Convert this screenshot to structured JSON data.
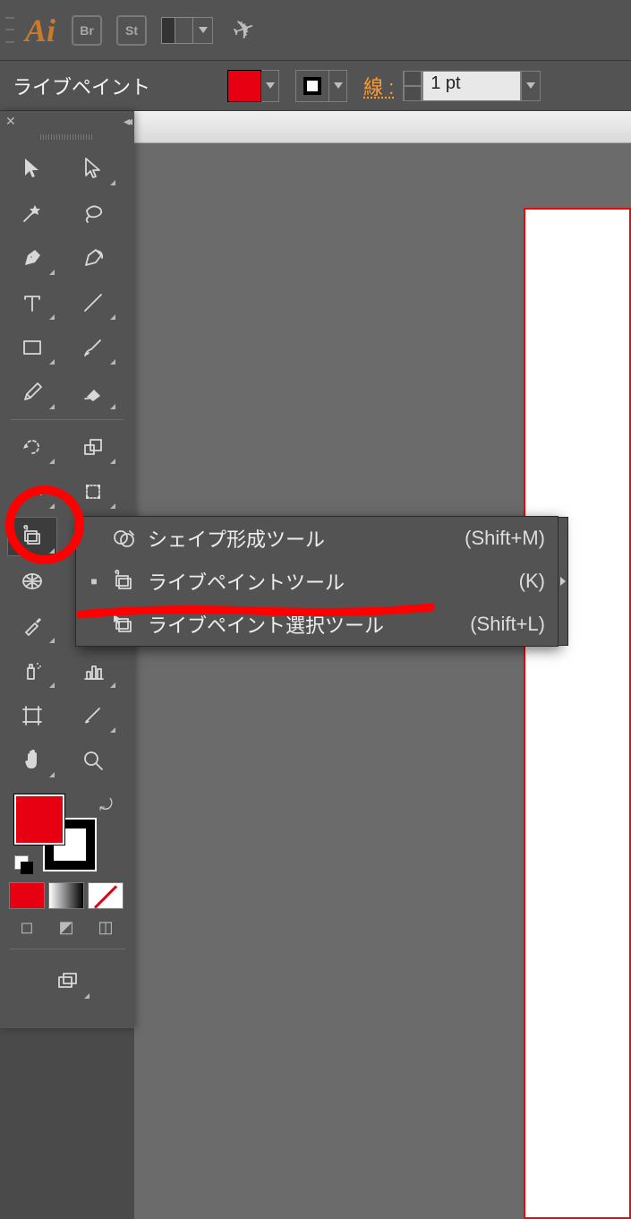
{
  "appbar": {
    "br_badge": "Br",
    "st_badge": "St"
  },
  "controlbar": {
    "tool_name": "ライブペイント",
    "stroke_label": "線 :",
    "stroke_value": "1 pt"
  },
  "flyout": {
    "items": [
      {
        "label": "シェイプ形成ツール",
        "shortcut": "(Shift+M)",
        "selected": false
      },
      {
        "label": "ライブペイントツール",
        "shortcut": "(K)",
        "selected": true
      },
      {
        "label": "ライブペイント選択ツール",
        "shortcut": "(Shift+L)",
        "selected": false
      }
    ]
  },
  "colors": {
    "fill": "#e60012",
    "stroke": "#000000",
    "accent": "#ff9a2b"
  }
}
